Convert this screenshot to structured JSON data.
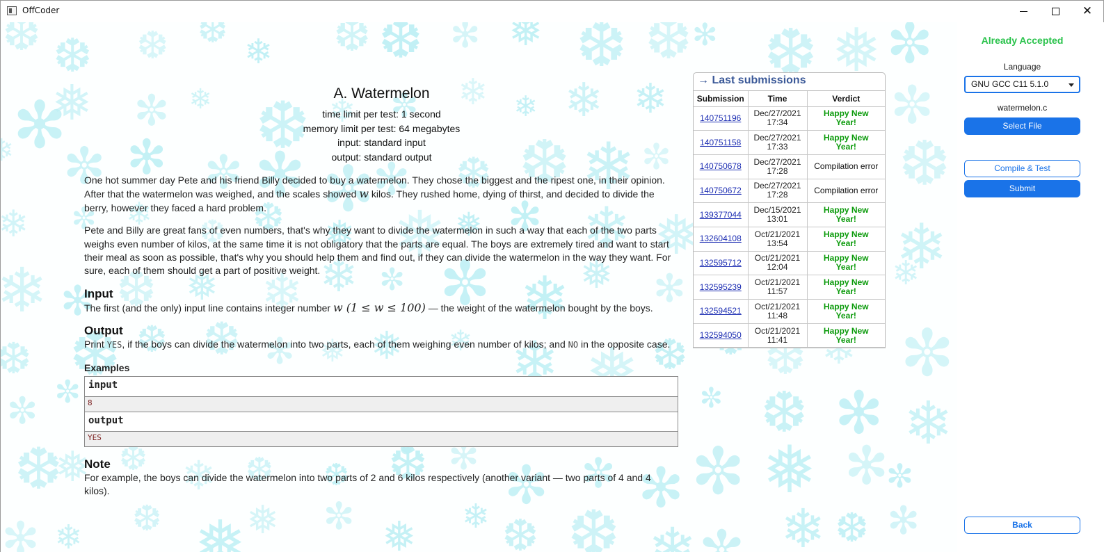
{
  "window": {
    "title": "OffCoder"
  },
  "problem": {
    "title": "A. Watermelon",
    "time_limit": "time limit per test: 1 second",
    "memory_limit": "memory limit per test: 64 megabytes",
    "input_file": "input: standard input",
    "output_file": "output: standard output",
    "para1_a": "One hot summer day Pete and his friend Billy decided to buy a watermelon. They chose the biggest and the ripest one, in their opinion. After that the watermelon was weighed, and the scales showed ",
    "para1_var": "w",
    "para1_b": " kilos. They rushed home, dying of thirst, and decided to divide the berry, however they faced a hard problem.",
    "para2": "Pete and Billy are great fans of even numbers, that's why they want to divide the watermelon in such a way that each of the two parts weighs even number of kilos, at the same time it is not obligatory that the parts are equal. The boys are extremely tired and want to start their meal as soon as possible, that's why you should help them and find out, if they can divide the watermelon in the way they want. For sure, each of them should get a part of positive weight.",
    "input_heading": "Input",
    "input_a": "The first (and the only) input line contains integer number ",
    "input_math": "w (1 ≤ w ≤ 100)",
    "input_b": " — the weight of the watermelon bought by the boys.",
    "output_heading": "Output",
    "output_a": "Print ",
    "output_yes": "YES",
    "output_b": ", if the boys can divide the watermelon into two parts, each of them weighing even number of kilos; and ",
    "output_no": "NO",
    "output_c": " in the opposite case.",
    "examples_heading": "Examples",
    "example_input_label": "input",
    "example_input_value": "8",
    "example_output_label": "output",
    "example_output_value": "YES",
    "note_heading": "Note",
    "note_text": "For example, the boys can divide the watermelon into two parts of 2 and 6 kilos respectively (another variant — two parts of 4 and 4 kilos)."
  },
  "submissions": {
    "title": "→ Last submissions",
    "headers": [
      "Submission",
      "Time",
      "Verdict"
    ],
    "rows": [
      {
        "id": "140751196",
        "date": "Dec/27/2021",
        "time": "17:34",
        "verdict": "Happy New Year!",
        "status": "ok"
      },
      {
        "id": "140751158",
        "date": "Dec/27/2021",
        "time": "17:33",
        "verdict": "Happy New Year!",
        "status": "ok"
      },
      {
        "id": "140750678",
        "date": "Dec/27/2021",
        "time": "17:28",
        "verdict": "Compilation error",
        "status": "ce"
      },
      {
        "id": "140750672",
        "date": "Dec/27/2021",
        "time": "17:28",
        "verdict": "Compilation error",
        "status": "ce"
      },
      {
        "id": "139377044",
        "date": "Dec/15/2021",
        "time": "13:01",
        "verdict": "Happy New Year!",
        "status": "ok"
      },
      {
        "id": "132604108",
        "date": "Oct/21/2021",
        "time": "13:54",
        "verdict": "Happy New Year!",
        "status": "ok"
      },
      {
        "id": "132595712",
        "date": "Oct/21/2021",
        "time": "12:04",
        "verdict": "Happy New Year!",
        "status": "ok"
      },
      {
        "id": "132595239",
        "date": "Oct/21/2021",
        "time": "11:57",
        "verdict": "Happy New Year!",
        "status": "ok"
      },
      {
        "id": "132594521",
        "date": "Oct/21/2021",
        "time": "11:48",
        "verdict": "Happy New Year!",
        "status": "ok"
      },
      {
        "id": "132594050",
        "date": "Oct/21/2021",
        "time": "11:41",
        "verdict": "Happy New Year!",
        "status": "ok"
      }
    ]
  },
  "sidebar": {
    "status": "Already Accepted",
    "language_label": "Language",
    "language_value": "GNU GCC C11 5.1.0",
    "file_name": "watermelon.c",
    "select_file": "Select File",
    "compile_test": "Compile & Test",
    "submit": "Submit",
    "back": "Back"
  },
  "colors": {
    "accent": "#1a73e8",
    "accepted": "#28c24a",
    "verdict_ok": "#0a9a0a",
    "link": "#1e2fb3",
    "panel_title": "#3b5998",
    "snowflake": "#bff0f5"
  },
  "icons": {
    "app": "app-window-icon",
    "minimize": "minimize-icon",
    "maximize": "maximize-icon",
    "close": "close-icon",
    "dropdown": "chevron-down-icon",
    "background": "snowflake-icon"
  }
}
